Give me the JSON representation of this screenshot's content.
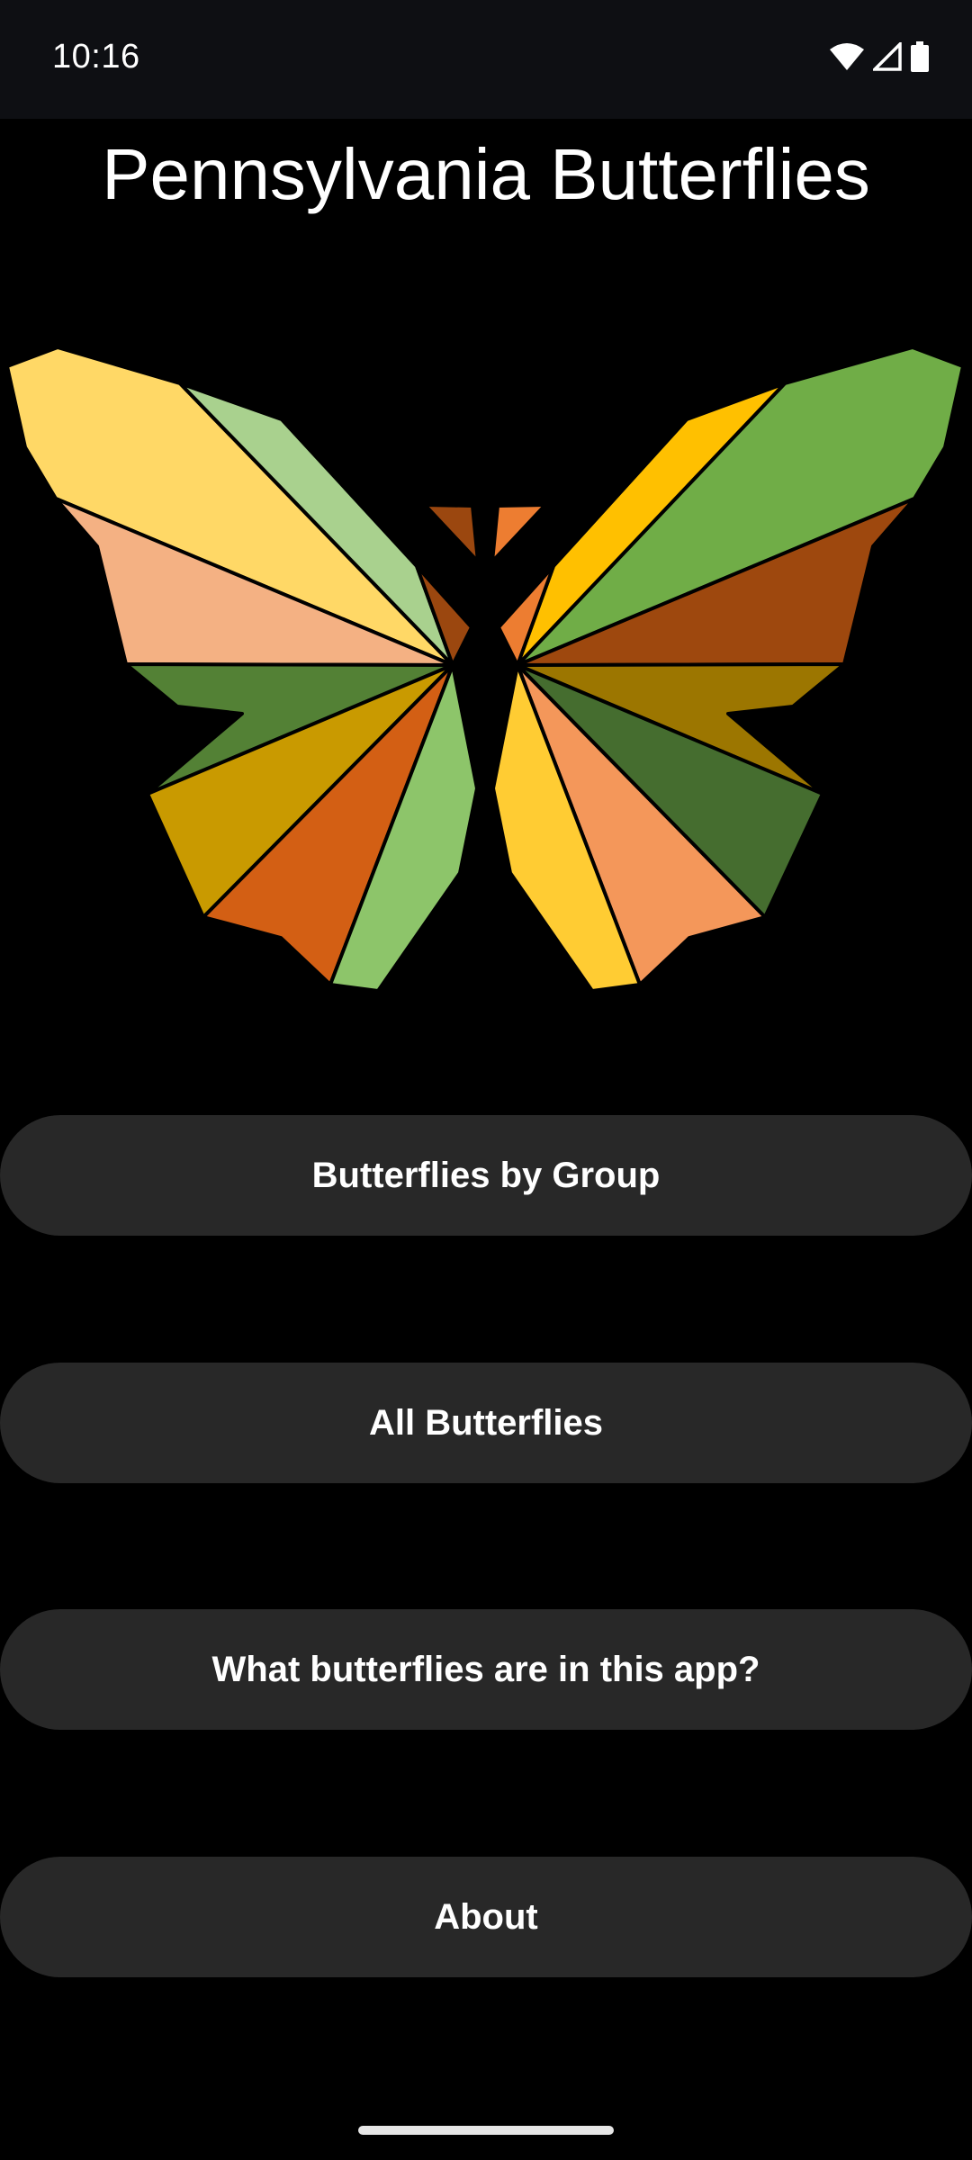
{
  "status_bar": {
    "time": "10:16",
    "icons": [
      "wifi-icon",
      "cellular-signal-icon",
      "battery-icon"
    ]
  },
  "app": {
    "title": "Pennsylvania Butterflies",
    "logo_icon": "butterfly-logo"
  },
  "menu": {
    "by_group_label": "Butterflies by Group",
    "all_label": "All Butterflies",
    "which_label": "What butterflies are in this app?",
    "about_label": "About"
  },
  "colors": {
    "background": "#000000",
    "status_bar": "#0e0f13",
    "button_bg": "#282828",
    "text": "#ffffff"
  }
}
